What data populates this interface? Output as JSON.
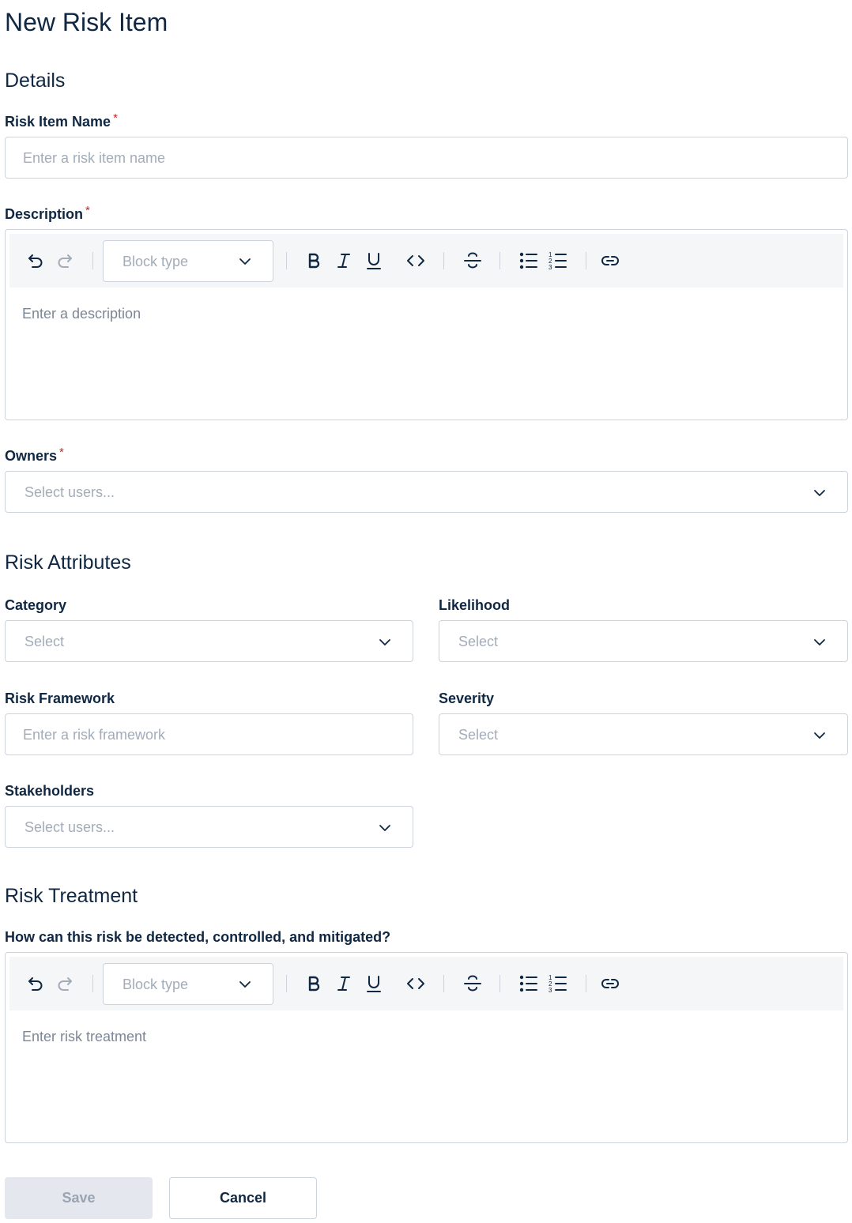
{
  "page": {
    "title": "New Risk Item"
  },
  "details": {
    "heading": "Details",
    "risk_item_name": {
      "label": "Risk Item Name",
      "required": "*",
      "placeholder": "Enter a risk item name"
    },
    "description": {
      "label": "Description",
      "required": "*",
      "block_type": "Block type",
      "placeholder": "Enter a description"
    },
    "owners": {
      "label": "Owners",
      "required": "*",
      "placeholder": "Select users..."
    }
  },
  "risk_attributes": {
    "heading": "Risk Attributes",
    "category": {
      "label": "Category",
      "placeholder": "Select"
    },
    "likelihood": {
      "label": "Likelihood",
      "placeholder": "Select"
    },
    "risk_framework": {
      "label": "Risk Framework",
      "placeholder": "Enter a risk framework"
    },
    "severity": {
      "label": "Severity",
      "placeholder": "Select"
    },
    "stakeholders": {
      "label": "Stakeholders",
      "placeholder": "Select users..."
    }
  },
  "risk_treatment": {
    "heading": "Risk Treatment",
    "question": {
      "label": "How can this risk be detected, controlled, and mitigated?",
      "block_type": "Block type",
      "placeholder": "Enter risk treatment"
    }
  },
  "actions": {
    "save": "Save",
    "cancel": "Cancel"
  },
  "colors": {
    "text": "#0f2742",
    "required": "#c62828",
    "placeholder": "#a3acb9",
    "border": "#ccd3dc",
    "toolbar_bg": "#f5f6f8",
    "disabled_bg": "#e4e8ee"
  }
}
